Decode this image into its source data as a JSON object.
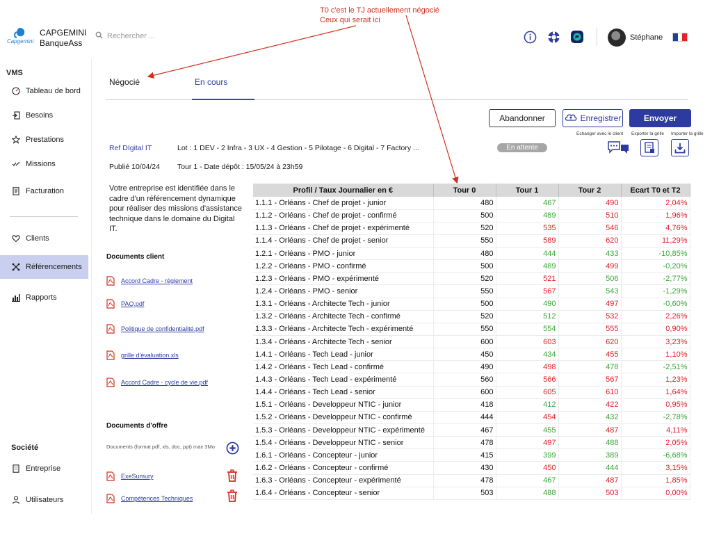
{
  "header": {
    "brand_line1": "CAPGEMINI",
    "brand_line2": "BanqueAss",
    "logo_text": "Capgemini",
    "search_placeholder": "Rechercher ...",
    "user_name": "Stéphane",
    "icons": [
      "info-icon",
      "support-icon",
      "chat-icon",
      "avatar",
      "france-flag-icon"
    ]
  },
  "annotation": {
    "line1": "T0 c'est le TJ actuellement négocié",
    "line2": "Ceux qui serait ici"
  },
  "sidebar": {
    "section_vms": "VMS",
    "items_vms": [
      {
        "label": "Tableau de bord",
        "icon": "dashboard-icon"
      },
      {
        "label": "Besoins",
        "icon": "login-icon"
      },
      {
        "label": "Prestations",
        "icon": "star-icon"
      },
      {
        "label": "Missions",
        "icon": "check-list-icon"
      },
      {
        "label": "Facturation",
        "icon": "document-icon"
      }
    ],
    "items_mid": [
      {
        "label": "Clients",
        "icon": "heart-icon"
      },
      {
        "label": "Référencements",
        "icon": "network-icon",
        "active": true
      },
      {
        "label": "Rapports",
        "icon": "bar-chart-icon"
      }
    ],
    "section_societe": "Société",
    "items_societe": [
      {
        "label": "Entreprise",
        "icon": "building-icon"
      },
      {
        "label": "Utilisateurs",
        "icon": "user-icon"
      }
    ]
  },
  "tabs": [
    {
      "label": "Négocié"
    },
    {
      "label": "En cours",
      "active": true
    }
  ],
  "actions": {
    "abandon": "Abandonner",
    "save": "Enregistrer",
    "send": "Envoyer",
    "exchange_label": "Echanger avec le client",
    "export_label": "Exporter la grille",
    "import_label": "Importer la grille"
  },
  "reference": {
    "ref": "Ref DIgital IT",
    "lots": "Lot : 1 DEV - 2 Infra - 3 UX - 4 Gestion - 5 Pilotage - 6 Digital - 7 Factory ...",
    "status": "En attente",
    "published": "Publié 10/04/24",
    "round": "Tour 1 - Date dépôt : 15/05/24 à 23h59"
  },
  "description": "Votre entreprise est identifiée dans le cadre d'un référencement dynamique pour réaliser des missions d'assistance technique dans le domaine du Digital IT.",
  "client_docs": {
    "title": "Documents client",
    "items": [
      "Accord Cadre - règlement",
      "PAQ.pdf",
      "Politique de confidentialité.pdf",
      "grille d'évaluation.xls",
      "Accord Cadre - cycle de vie.pdf"
    ]
  },
  "offer_docs": {
    "title": "Documents d'offre",
    "hint": "Documents (format pdf, xls, doc, ppt) max 3Mo",
    "items": [
      "ExeSumury",
      "Compétences Techniques"
    ]
  },
  "colors": {
    "accent": "#2d3aa0",
    "green": "#3aa63a",
    "red": "#e0202b",
    "active_nav": "#c9cfef",
    "annotation": "#d0301e"
  },
  "table": {
    "headers": [
      "Profil / Taux Journalier en €",
      "Tour 0",
      "Tour 1",
      "Tour 2",
      "Ecart T0 et T2"
    ],
    "rows": [
      {
        "profil": "1.1.1 - Orléans - Chef de projet - junior",
        "t0": "480",
        "t1": "467",
        "t1c": "green",
        "t2": "490",
        "t2c": "red",
        "ecart": "2,04%",
        "ec": "red"
      },
      {
        "profil": "1.1.2 - Orléans - Chef de projet - confirmé",
        "t0": "500",
        "t1": "489",
        "t1c": "green",
        "t2": "510",
        "t2c": "red",
        "ecart": "1,96%",
        "ec": "red"
      },
      {
        "profil": "1.1.3 - Orléans - Chef de projet - expérimenté",
        "t0": "520",
        "t1": "535",
        "t1c": "red",
        "t2": "546",
        "t2c": "red",
        "ecart": "4,76%",
        "ec": "red"
      },
      {
        "profil": "1.1.4 - Orléans - Chef de projet - senior",
        "t0": "550",
        "t1": "589",
        "t1c": "red",
        "t2": "620",
        "t2c": "red",
        "ecart": "11,29%",
        "ec": "red"
      },
      {
        "profil": "1.2.1 - Orléans - PMO - junior",
        "t0": "480",
        "t1": "444",
        "t1c": "green",
        "t2": "433",
        "t2c": "green",
        "ecart": "-10,85%",
        "ec": "green"
      },
      {
        "profil": "1.2.2 - Orléans - PMO - confirmé",
        "t0": "500",
        "t1": "489",
        "t1c": "green",
        "t2": "499",
        "t2c": "red",
        "ecart": "-0,20%",
        "ec": "green"
      },
      {
        "profil": "1.2.3 - Orléans - PMO - expérimenté",
        "t0": "520",
        "t1": "521",
        "t1c": "red",
        "t2": "506",
        "t2c": "green",
        "ecart": "-2,77%",
        "ec": "green"
      },
      {
        "profil": "1.2.4 - Orléans - PMO - senior",
        "t0": "550",
        "t1": "567",
        "t1c": "red",
        "t2": "543",
        "t2c": "green",
        "ecart": "-1,29%",
        "ec": "green"
      },
      {
        "profil": "1.3.1 - Orléans - Architecte Tech - junior",
        "t0": "500",
        "t1": "490",
        "t1c": "green",
        "t2": "497",
        "t2c": "red",
        "ecart": "-0,60%",
        "ec": "green"
      },
      {
        "profil": "1.3.2 - Orléans - Architecte Tech - confirmé",
        "t0": "520",
        "t1": "512",
        "t1c": "green",
        "t2": "532",
        "t2c": "red",
        "ecart": "2,26%",
        "ec": "red"
      },
      {
        "profil": "1.3.3 - Orléans - Architecte Tech - expérimenté",
        "t0": "550",
        "t1": "554",
        "t1c": "green",
        "t2": "555",
        "t2c": "red",
        "ecart": "0,90%",
        "ec": "red"
      },
      {
        "profil": "1.3.4 - Orléans - Architecte Tech - senior",
        "t0": "600",
        "t1": "603",
        "t1c": "red",
        "t2": "620",
        "t2c": "red",
        "ecart": "3,23%",
        "ec": "red"
      },
      {
        "profil": "1.4.1 - Orléans - Tech Lead - junior",
        "t0": "450",
        "t1": "434",
        "t1c": "green",
        "t2": "455",
        "t2c": "red",
        "ecart": "1,10%",
        "ec": "red"
      },
      {
        "profil": "1.4.2 - Orléans - Tech Lead - confirmé",
        "t0": "490",
        "t1": "498",
        "t1c": "red",
        "t2": "478",
        "t2c": "green",
        "ecart": "-2,51%",
        "ec": "green"
      },
      {
        "profil": "1.4.3 - Orléans - Tech Lead - expérimenté",
        "t0": "560",
        "t1": "566",
        "t1c": "red",
        "t2": "567",
        "t2c": "red",
        "ecart": "1,23%",
        "ec": "red"
      },
      {
        "profil": "1.4.4 - Orléans - Tech Lead - senior",
        "t0": "600",
        "t1": "605",
        "t1c": "red",
        "t2": "610",
        "t2c": "red",
        "ecart": "1,64%",
        "ec": "red"
      },
      {
        "profil": "1.5.1 - Orléans - Developpeur NTIC - junior",
        "t0": "418",
        "t1": "412",
        "t1c": "green",
        "t2": "422",
        "t2c": "red",
        "ecart": "0,95%",
        "ec": "red"
      },
      {
        "profil": "1.5.2 - Orléans - Developpeur NTIC - confirmé",
        "t0": "444",
        "t1": "454",
        "t1c": "red",
        "t2": "432",
        "t2c": "green",
        "ecart": "-2,78%",
        "ec": "green"
      },
      {
        "profil": "1.5.3 - Orléans - Developpeur NTIC - expérimenté",
        "t0": "467",
        "t1": "455",
        "t1c": "green",
        "t2": "487",
        "t2c": "red",
        "ecart": "4,11%",
        "ec": "red"
      },
      {
        "profil": "1.5.4 - Orléans - Developpeur NTIC - senior",
        "t0": "478",
        "t1": "497",
        "t1c": "red",
        "t2": "488",
        "t2c": "green",
        "ecart": "2,05%",
        "ec": "red"
      },
      {
        "profil": "1.6.1 - Orléans - Concepteur - junior",
        "t0": "415",
        "t1": "399",
        "t1c": "green",
        "t2": "389",
        "t2c": "green",
        "ecart": "-6,68%",
        "ec": "green"
      },
      {
        "profil": "1.6.2 - Orléans - Concepteur - confirmé",
        "t0": "430",
        "t1": "450",
        "t1c": "red",
        "t2": "444",
        "t2c": "green",
        "ecart": "3,15%",
        "ec": "red"
      },
      {
        "profil": "1.6.3 - Orléans - Concepteur - expérimenté",
        "t0": "478",
        "t1": "467",
        "t1c": "green",
        "t2": "487",
        "t2c": "red",
        "ecart": "1,85%",
        "ec": "red"
      },
      {
        "profil": "1.6.4 - Orléans - Concepteur - senior",
        "t0": "503",
        "t1": "488",
        "t1c": "green",
        "t2": "503",
        "t2c": "red",
        "ecart": "0,00%",
        "ec": "red"
      }
    ]
  }
}
